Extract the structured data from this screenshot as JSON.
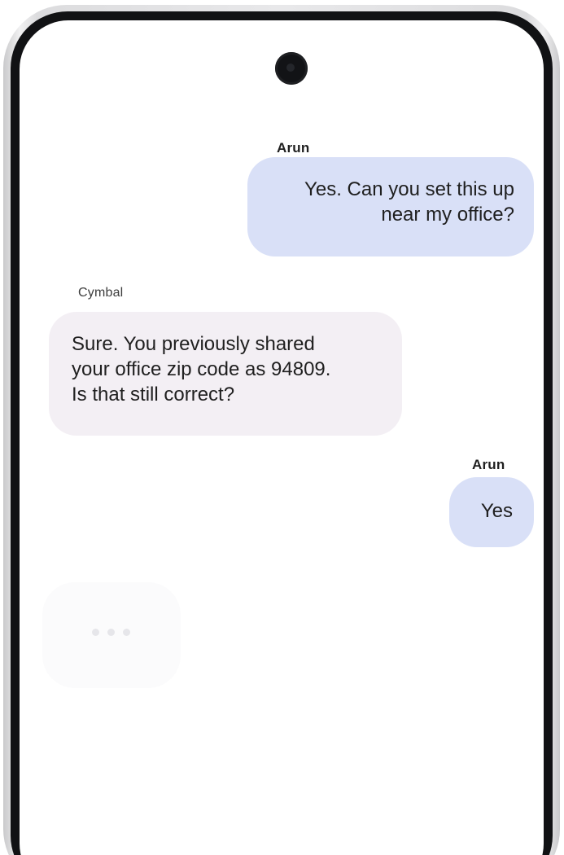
{
  "chat": {
    "messages": [
      {
        "sender": "Arun",
        "role": "user",
        "text_lines": [
          "Yes. Can you set this up",
          "near my office?"
        ]
      },
      {
        "sender": "Cymbal",
        "role": "bot",
        "text_lines": [
          "Sure. You previously shared",
          "your office zip code as 94809.",
          "Is that still correct?"
        ]
      },
      {
        "sender": "Arun",
        "role": "user",
        "text_lines": [
          "Yes"
        ]
      }
    ],
    "typing_indicator": true
  },
  "colors": {
    "user_bubble": "#d9e0f7",
    "bot_bubble": "#f3eff4",
    "text": "#1f1f1f",
    "frame": "#111214"
  }
}
